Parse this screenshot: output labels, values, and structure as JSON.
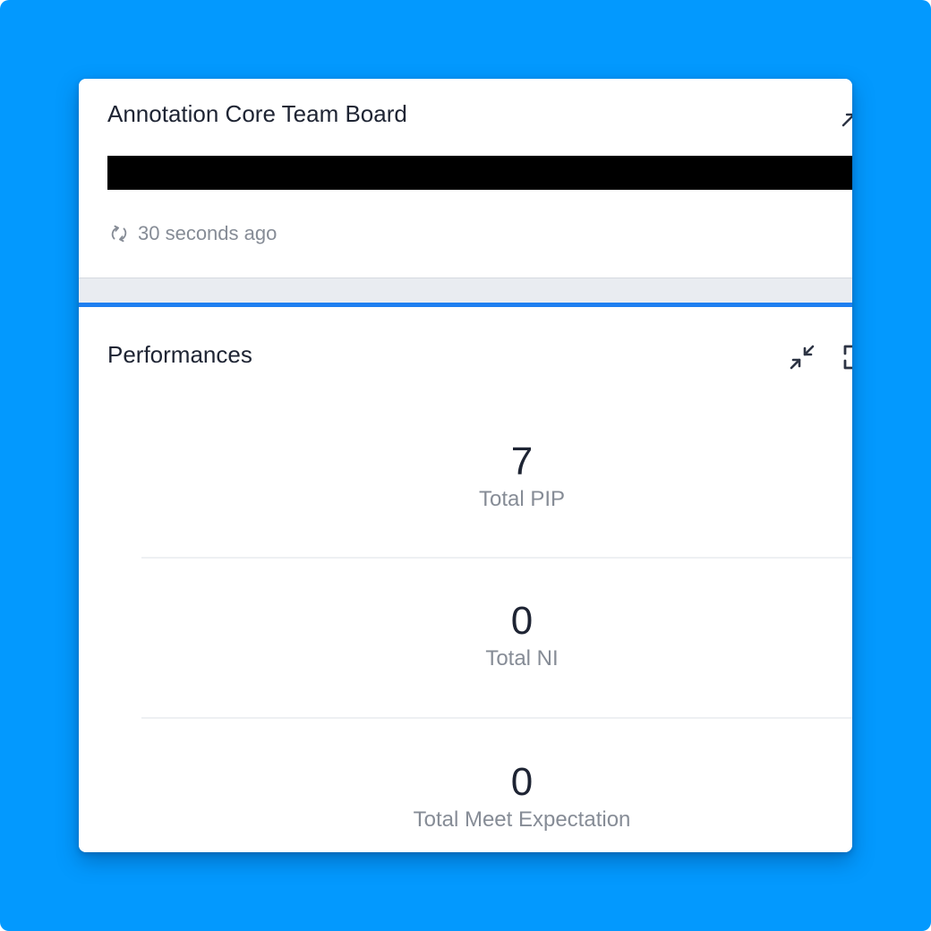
{
  "board": {
    "title": "Annotation Core Team Board",
    "refresh_text": "30 seconds ago",
    "refresh_icon": "refresh-icon",
    "expand_icon": "expand-icon"
  },
  "performances": {
    "title": "Performances",
    "collapse_icon": "collapse-icon",
    "fullscreen_icon": "fullscreen-icon",
    "stats": [
      {
        "value": "7",
        "label": "Total PIP"
      },
      {
        "value": "0",
        "label": "Total NI"
      },
      {
        "value": "0",
        "label": "Total Meet Expectation"
      }
    ]
  },
  "colors": {
    "background": "#0399fe",
    "panel_accent": "#1f7ff0",
    "title_text": "#1e2433",
    "muted_text": "#868c96"
  }
}
